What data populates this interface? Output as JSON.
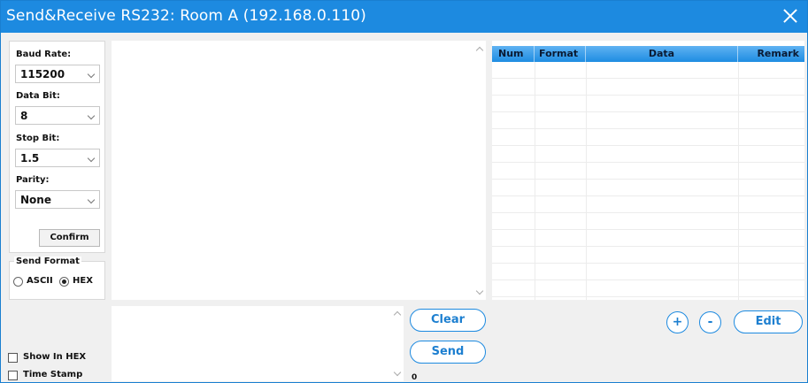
{
  "window": {
    "title": "Send&Receive RS232: Room A (192.168.0.110)"
  },
  "settings": {
    "baud_rate": {
      "label": "Baud Rate:",
      "value": "115200"
    },
    "data_bit": {
      "label": "Data Bit:",
      "value": "8"
    },
    "stop_bit": {
      "label": "Stop Bit:",
      "value": "1.5"
    },
    "parity": {
      "label": "Parity:",
      "value": "None"
    },
    "confirm_label": "Confirm"
  },
  "send_format": {
    "legend": "Send Format",
    "options": [
      {
        "label": "ASCII",
        "selected": false
      },
      {
        "label": "HEX",
        "selected": true
      }
    ]
  },
  "options": {
    "show_in_hex": {
      "label": "Show In HEX",
      "checked": false
    },
    "time_stamp": {
      "label": "Time Stamp",
      "checked": false
    }
  },
  "actions": {
    "clear_label": "Clear",
    "send_label": "Send",
    "char_count": "0"
  },
  "table": {
    "columns": [
      "Num",
      "Format",
      "Data",
      "Remark"
    ],
    "rows": []
  },
  "table_actions": {
    "add_label": "+",
    "remove_label": "-",
    "edit_label": "Edit"
  },
  "colors": {
    "accent": "#1d8ae0"
  }
}
